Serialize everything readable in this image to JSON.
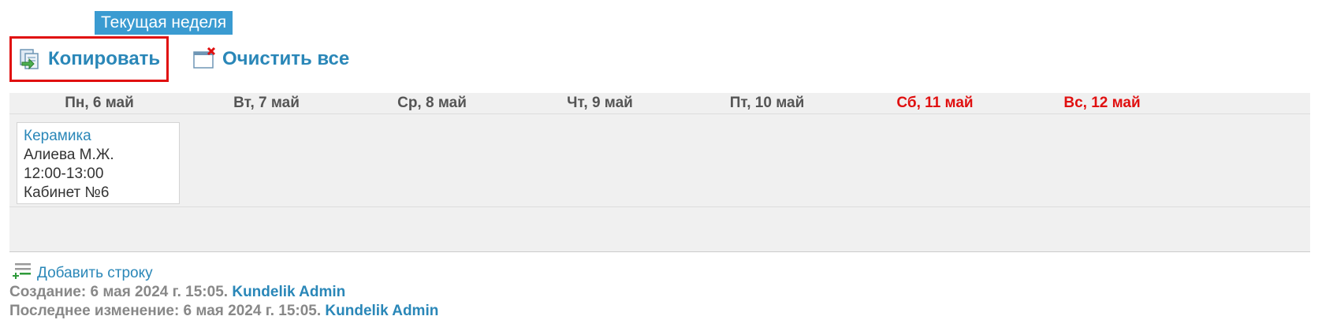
{
  "week_badge": "Текущая неделя",
  "toolbar": {
    "copy_label": "Копировать",
    "copy_icon": "copy-icon",
    "clear_label": "Очистить все",
    "clear_icon": "clear-all-icon"
  },
  "colors": {
    "accent": "#2a87b8",
    "badge": "#3a9bd1",
    "weekend": "#e01010",
    "highlight_border": "#e01010",
    "grid_bg": "#f0f0f0"
  },
  "days": [
    {
      "label": "Пн, 6 май",
      "weekend": false
    },
    {
      "label": "Вт, 7 май",
      "weekend": false
    },
    {
      "label": "Ср, 8 май",
      "weekend": false
    },
    {
      "label": "Чт, 9 май",
      "weekend": false
    },
    {
      "label": "Пт, 10 май",
      "weekend": false
    },
    {
      "label": "Сб, 11 май",
      "weekend": true
    },
    {
      "label": "Вс, 12 май",
      "weekend": true
    }
  ],
  "lessons": [
    {
      "subject": "Керамика",
      "teacher": "Алиева М.Ж.",
      "time": "12:00-13:00",
      "room": "Кабинет №6"
    }
  ],
  "add_row": {
    "label": "Добавить строку",
    "icon": "add-row-icon"
  },
  "meta": {
    "created_prefix": "Создание: 6 мая 2024 г. 15:05.",
    "created_by": "Kundelik Admin",
    "modified_prefix": "Последнее изменение: 6 мая 2024 г. 15:05.",
    "modified_by": "Kundelik Admin"
  }
}
